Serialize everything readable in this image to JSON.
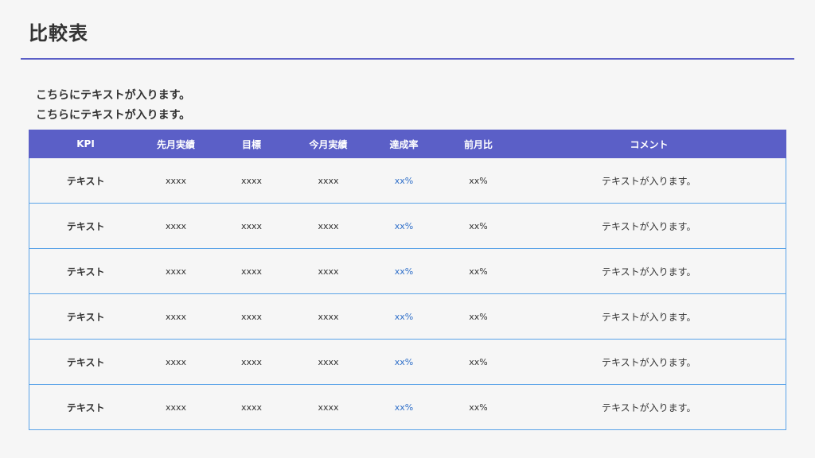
{
  "slide": {
    "title": "比較表",
    "intro_lines": [
      "こちらにテキストが入ります。",
      "こちらにテキストが入ります。"
    ]
  },
  "colors": {
    "accent": "#5b5fc7",
    "row_border": "#5aa3e8",
    "rate_text": "#2f6fc9"
  },
  "table": {
    "headers": [
      "KPI",
      "先月実績",
      "目標",
      "今月実績",
      "達成率",
      "前月比",
      "コメント"
    ],
    "rows": [
      [
        "テキスト",
        "xxxx",
        "xxxx",
        "xxxx",
        "xx%",
        "xx%",
        "テキストが入ります。"
      ],
      [
        "テキスト",
        "xxxx",
        "xxxx",
        "xxxx",
        "xx%",
        "xx%",
        "テキストが入ります。"
      ],
      [
        "テキスト",
        "xxxx",
        "xxxx",
        "xxxx",
        "xx%",
        "xx%",
        "テキストが入ります。"
      ],
      [
        "テキスト",
        "xxxx",
        "xxxx",
        "xxxx",
        "xx%",
        "xx%",
        "テキストが入ります。"
      ],
      [
        "テキスト",
        "xxxx",
        "xxxx",
        "xxxx",
        "xx%",
        "xx%",
        "テキストが入ります。"
      ],
      [
        "テキスト",
        "xxxx",
        "xxxx",
        "xxxx",
        "xx%",
        "xx%",
        "テキストが入ります。"
      ]
    ]
  }
}
